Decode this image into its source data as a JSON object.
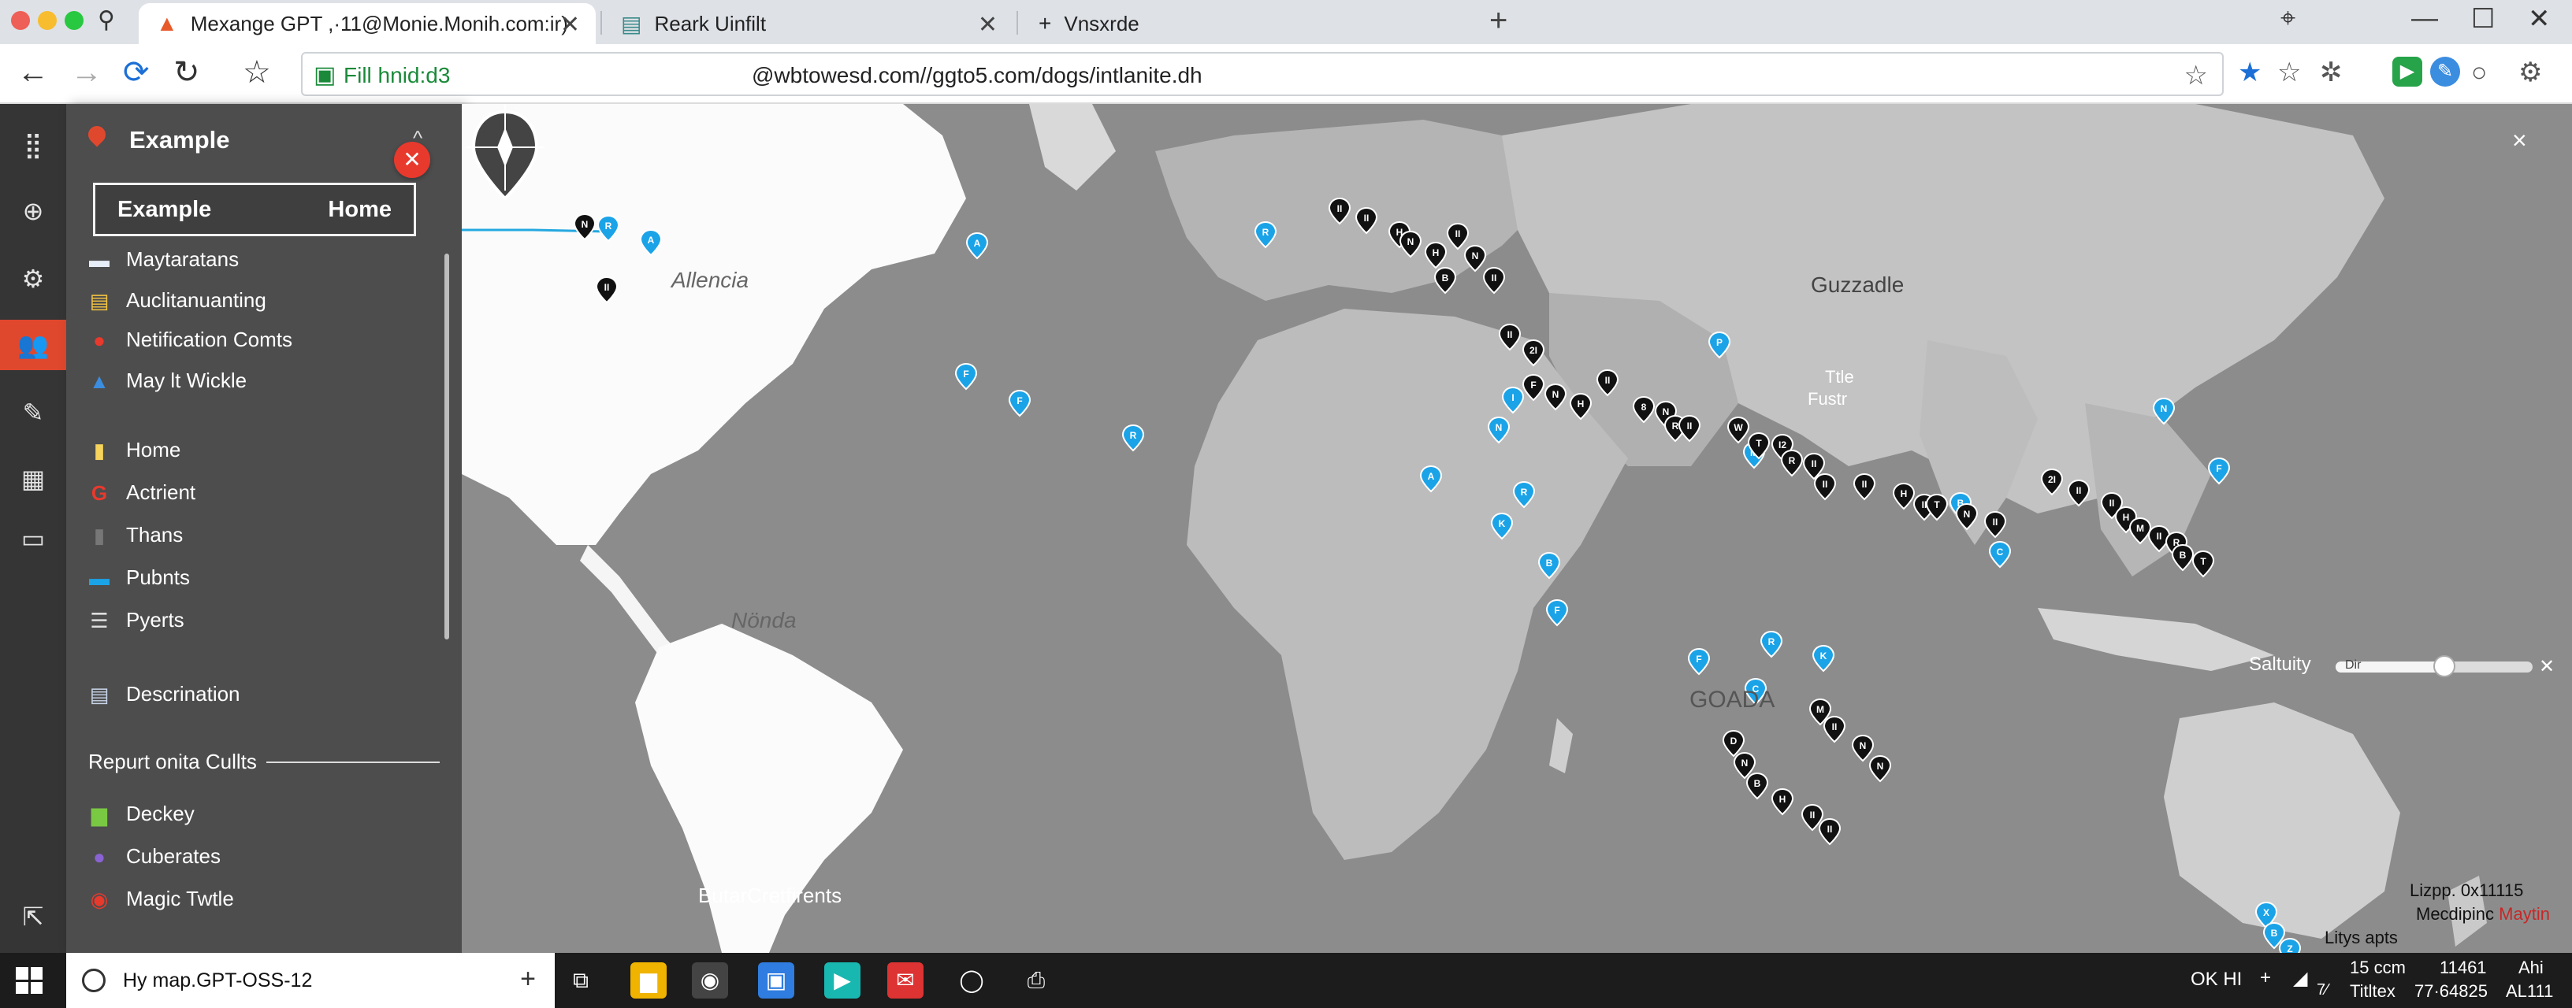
{
  "browser": {
    "tabs": [
      {
        "title": "Mexange GPT ,·11@Monie.Monih.com:ir)",
        "favicon": "warning-triangle-icon",
        "active": true
      },
      {
        "title": "Reark Uinfilt",
        "favicon": "document-icon",
        "active": false
      },
      {
        "title": "Vnsxrde",
        "favicon": "plus-icon",
        "active": false
      }
    ],
    "url_secure": "Fill hnid:d3",
    "url_path": "@wbtowesd.com//ggto5.com/dogs/intlanite.dh"
  },
  "sidebar": {
    "brand": "Example",
    "selector": {
      "left": "Example",
      "right": "Home"
    },
    "top_items": [
      {
        "label": "Maytaratans",
        "icon": "folder-icon"
      },
      {
        "label": "Auclitanuanting",
        "icon": "calendar-icon"
      },
      {
        "label": "Netification Comts",
        "icon": "location-pin-icon"
      },
      {
        "label": "May lt Wickle",
        "icon": "drive-icon"
      }
    ],
    "mid_items": [
      {
        "label": "Home",
        "icon": "note-icon"
      },
      {
        "label": "Actrient",
        "icon": "google-icon"
      },
      {
        "label": "Thans",
        "icon": "page-icon"
      },
      {
        "label": "Pubnts",
        "icon": "folder-icon"
      },
      {
        "label": "Pyerts",
        "icon": "list-icon"
      }
    ],
    "desc_item": {
      "label": "Descrination",
      "icon": "document-icon"
    },
    "section_title": "Repurt onita Cullts",
    "bottom_items": [
      {
        "label": "Deckey",
        "icon": "chat-icon"
      },
      {
        "label": "Cuberates",
        "icon": "facebook-icon"
      },
      {
        "label": "Magic Twtle",
        "icon": "map-pin-icon"
      }
    ]
  },
  "map": {
    "labels": {
      "alliance": "Allencia",
      "south": "Nönda",
      "asia": "Guzzadle",
      "title_pin": "Ttle",
      "fustr": "Fustr",
      "ocean": "GOADA",
      "saltuity": "Saltuity",
      "bottom_left": "ButarCretfirents"
    },
    "slider": {
      "label": "Dir",
      "value": 0.55
    },
    "corner": {
      "line1": "Lizpp. 0x11115",
      "line2": "Mecdipinc",
      "line2_accent": "Maytin",
      "line3": "Litys apts"
    },
    "markers_blue": [
      "R",
      "A",
      "A",
      "F",
      "F",
      "R",
      "R",
      "N",
      "A",
      "R",
      "I",
      "P",
      "M",
      "R",
      "K",
      "B",
      "C",
      "N",
      "F",
      "F",
      "C",
      "X",
      "B",
      "Z",
      "K",
      "B",
      "F"
    ],
    "markers_black": [
      "N",
      "II",
      "II",
      "II",
      "H",
      "N",
      "H",
      "II",
      "N",
      "B",
      "II",
      "II",
      "2I",
      "F",
      "N",
      "H",
      "II",
      "8",
      "N",
      "R",
      "II",
      "W",
      "T",
      "I2",
      "R",
      "II",
      "II",
      "II",
      "H",
      "II",
      "T",
      "N",
      "II",
      "2I",
      "II",
      "II",
      "H",
      "M",
      "II",
      "R",
      "B",
      "T",
      "M",
      "II",
      "N",
      "N",
      "D",
      "N",
      "B",
      "H",
      "II",
      "II"
    ]
  },
  "taskbar": {
    "search": "Hy map.GPT-OSS-12",
    "tray_ok": "OK HI",
    "tray_temp": "15 ccm",
    "tray_sub": "Titltex",
    "tray_num1": "11461",
    "tray_num2": "77·64825",
    "tray_user1": "Ahi",
    "tray_user2": "AL111",
    "tray_arrow": "7⁄"
  }
}
